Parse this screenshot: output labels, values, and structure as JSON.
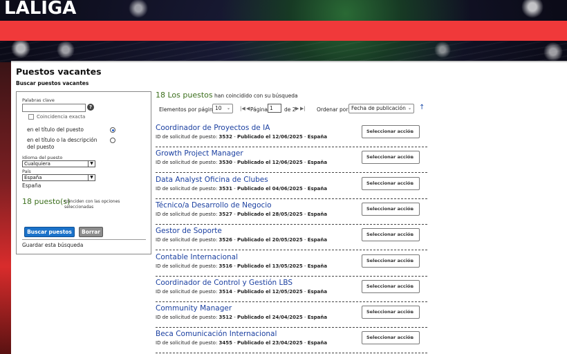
{
  "brand": {
    "logo_text": "LALIGA",
    "accent_red": "#f0393a"
  },
  "page": {
    "title": "Puestos vacantes",
    "subtitle": "Buscar puestos vacantes"
  },
  "filters": {
    "keywords_label": "Palabras clave",
    "keywords_value": "",
    "help_icon": "?",
    "exact_match_label": "Coincidencia exacta",
    "search_in_title_label": "en el título del puesto",
    "search_in_title_desc_label": "en el título o la descripción del puesto",
    "language_label": "Idioma del puesto",
    "language_value": "Cualquiera",
    "country_label": "País",
    "country_value": "España",
    "country_selected_display": "España",
    "match_count": "18 puesto(s)",
    "match_note": "coinciden con las opciones seleccionadas",
    "search_button": "Buscar puestos",
    "clear_button": "Borrar",
    "save_search": "Guardar esta búsqueda"
  },
  "results": {
    "count_number": "18 Los puestos",
    "count_text": "han coincidido con su búsqueda",
    "per_page_label": "Elementos por página",
    "per_page_value": "10",
    "page_label": "Página",
    "page_value": "1",
    "page_of": "de 2",
    "sort_label": "Ordenar por:",
    "sort_value": "Fecha de publicación",
    "sort_icon": "↑",
    "action_label": "Seleccionar acción"
  },
  "jobs": [
    {
      "title": "Coordinador de Proyectos de IA",
      "id_label": "ID de solicitud de puesto:",
      "id": "3532",
      "published": "Publicado el 12/06/2025",
      "country": "España"
    },
    {
      "title": "Growth Project Manager",
      "id_label": "ID de solicitud de puesto:",
      "id": "3530",
      "published": "Publicado el 12/06/2025",
      "country": "España"
    },
    {
      "title": "Data Analyst Oficina de Clubes",
      "id_label": "ID de solicitud de puesto:",
      "id": "3531",
      "published": "Publicado el 04/06/2025",
      "country": "España"
    },
    {
      "title": "Técnico/a Desarrollo de Negocio",
      "id_label": "ID de solicitud de puesto:",
      "id": "3527",
      "published": "Publicado el 28/05/2025",
      "country": "España"
    },
    {
      "title": "Gestor de Soporte",
      "id_label": "ID de solicitud de puesto:",
      "id": "3526",
      "published": "Publicado el 20/05/2025",
      "country": "España"
    },
    {
      "title": "Contable Internacional",
      "id_label": "ID de solicitud de puesto:",
      "id": "3516",
      "published": "Publicado el 13/05/2025",
      "country": "España"
    },
    {
      "title": "Coordinador de Control y Gestión LBS",
      "id_label": "ID de solicitud de puesto:",
      "id": "3514",
      "published": "Publicado el 12/05/2025",
      "country": "España"
    },
    {
      "title": "Community Manager",
      "id_label": "ID de solicitud de puesto:",
      "id": "3512",
      "published": "Publicado el 24/04/2025",
      "country": "España"
    },
    {
      "title": "Beca Comunicación Internacional",
      "id_label": "ID de solicitud de puesto:",
      "id": "3455",
      "published": "Publicado el 23/04/2025",
      "country": "España"
    }
  ]
}
